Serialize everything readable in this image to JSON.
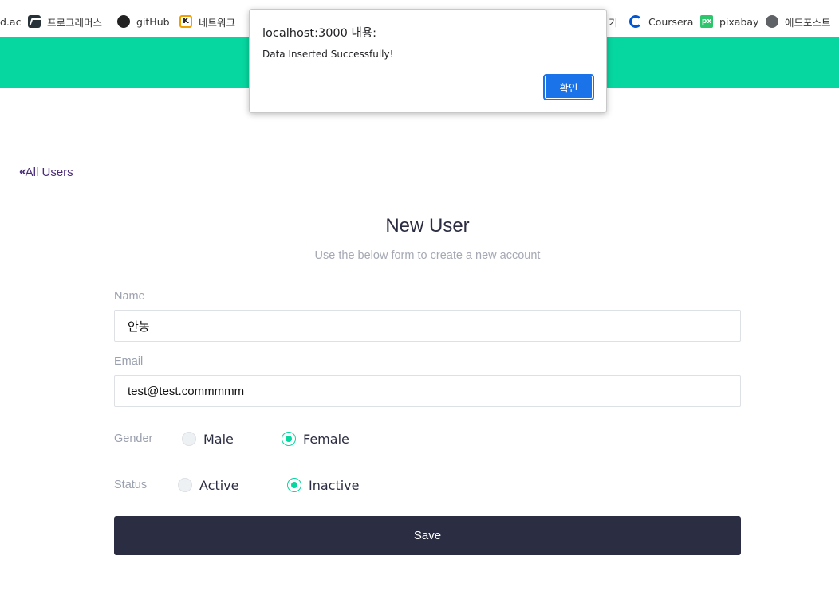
{
  "bookmarks": [
    {
      "label": "d.ac",
      "icon": "none"
    },
    {
      "label": "프로그래머스",
      "icon": "programmers-icon"
    },
    {
      "label": "gitHub",
      "icon": "github-icon"
    },
    {
      "label": "네트워크",
      "icon": "k-icon"
    },
    {
      "label": "기",
      "icon": "none"
    },
    {
      "label": "Coursera",
      "icon": "coursera-icon"
    },
    {
      "label": "pixabay",
      "icon": "pixabay-icon"
    },
    {
      "label": "애드포스트",
      "icon": "globe-icon"
    }
  ],
  "header": {
    "accent_color": "#06d6a0"
  },
  "back_link": {
    "label": "All Users",
    "icon": "double-chevron-left-icon"
  },
  "page": {
    "title": "New User",
    "subtitle": "Use the below form to create a new account"
  },
  "form": {
    "name_label": "Name",
    "name_value": "안농",
    "email_label": "Email",
    "email_value": "test@test.commmmm",
    "gender_label": "Gender",
    "gender_options": [
      "Male",
      "Female"
    ],
    "gender_selected": "Female",
    "status_label": "Status",
    "status_options": [
      "Active",
      "Inactive"
    ],
    "status_selected": "Inactive",
    "save_label": "Save"
  },
  "dialog": {
    "title": "localhost:3000 내용:",
    "message": "Data Inserted Successfully!",
    "ok_label": "확인"
  },
  "colors": {
    "dark": "#2b2d42",
    "muted": "#9aa0ad",
    "link": "#4a2b7a",
    "dialog_button": "#1a73e8"
  }
}
